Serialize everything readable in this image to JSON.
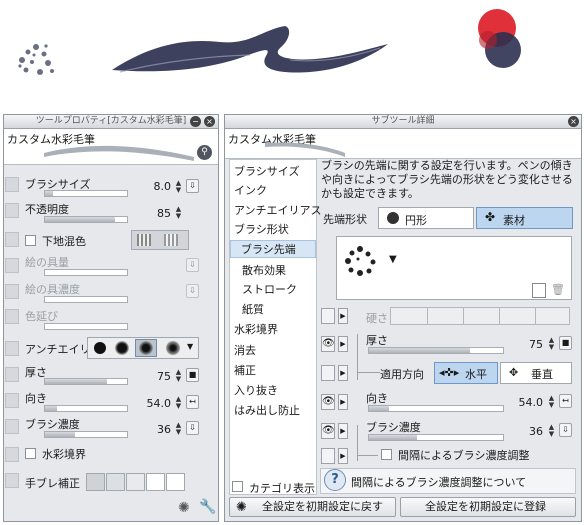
{
  "colors": {
    "brush_ink": "#2c3150",
    "accent_red": "#e0303a",
    "panel_bg": "#e6e8eb",
    "selection": "#d7e6f5"
  },
  "tool_property": {
    "title": "ツールプロパティ[カスタム水彩毛筆]",
    "brush_name": "カスタム水彩毛筆",
    "rows": [
      {
        "label": "ブラシサイズ",
        "value": "8.0",
        "fill": 0.1
      },
      {
        "label": "不透明度",
        "value": "85",
        "fill": 0.85
      },
      {
        "label": "下地混色"
      },
      {
        "label": "絵の具量"
      },
      {
        "label": "絵の具濃度"
      },
      {
        "label": "色延び"
      },
      {
        "label": "アンチエイリア"
      },
      {
        "label": "厚さ",
        "value": "75",
        "fill": 0.75
      },
      {
        "label": "向き",
        "value": "54.0",
        "fill": 0.15
      },
      {
        "label": "ブラシ濃度",
        "value": "36",
        "fill": 0.36
      },
      {
        "label": "水彩境界"
      },
      {
        "label": "手ブレ補正"
      }
    ]
  },
  "sub_tool_detail": {
    "title": "サブツール詳細",
    "brush_name": "カスタム水彩毛筆",
    "categories": [
      "ブラシサイズ",
      "インク",
      "アンチエイリアス",
      "ブラシ形状",
      "ブラシ先端",
      "散布効果",
      "ストローク",
      "紙質",
      "水彩境界",
      "消去",
      "補正",
      "入り抜き",
      "はみ出し防止"
    ],
    "active_category": "ブラシ先端",
    "description": "ブラシの先端に関する設定を行います。ペンの傾きや向きによってブラシ先端の形状をどう変化させるかも設定できます。",
    "tip_shape_label": "先端形状",
    "tip_circle": "円形",
    "tip_material": "素材",
    "hardness_label": "硬さ",
    "thickness_label": "厚さ",
    "thickness_value": "75",
    "apply_direction_label": "適用方向",
    "horizontal": "水平",
    "vertical": "垂直",
    "direction_label": "向き",
    "direction_value": "54.0",
    "density_label": "ブラシ濃度",
    "density_value": "36",
    "interval_density": "間隔によるブラシ濃度調整",
    "help_text": "間隔によるブラシ濃度調整について",
    "category_display": "カテゴリ表示",
    "reset_all": "全設定を初期設定に戻す",
    "register_all": "全設定を初期設定に登録"
  }
}
